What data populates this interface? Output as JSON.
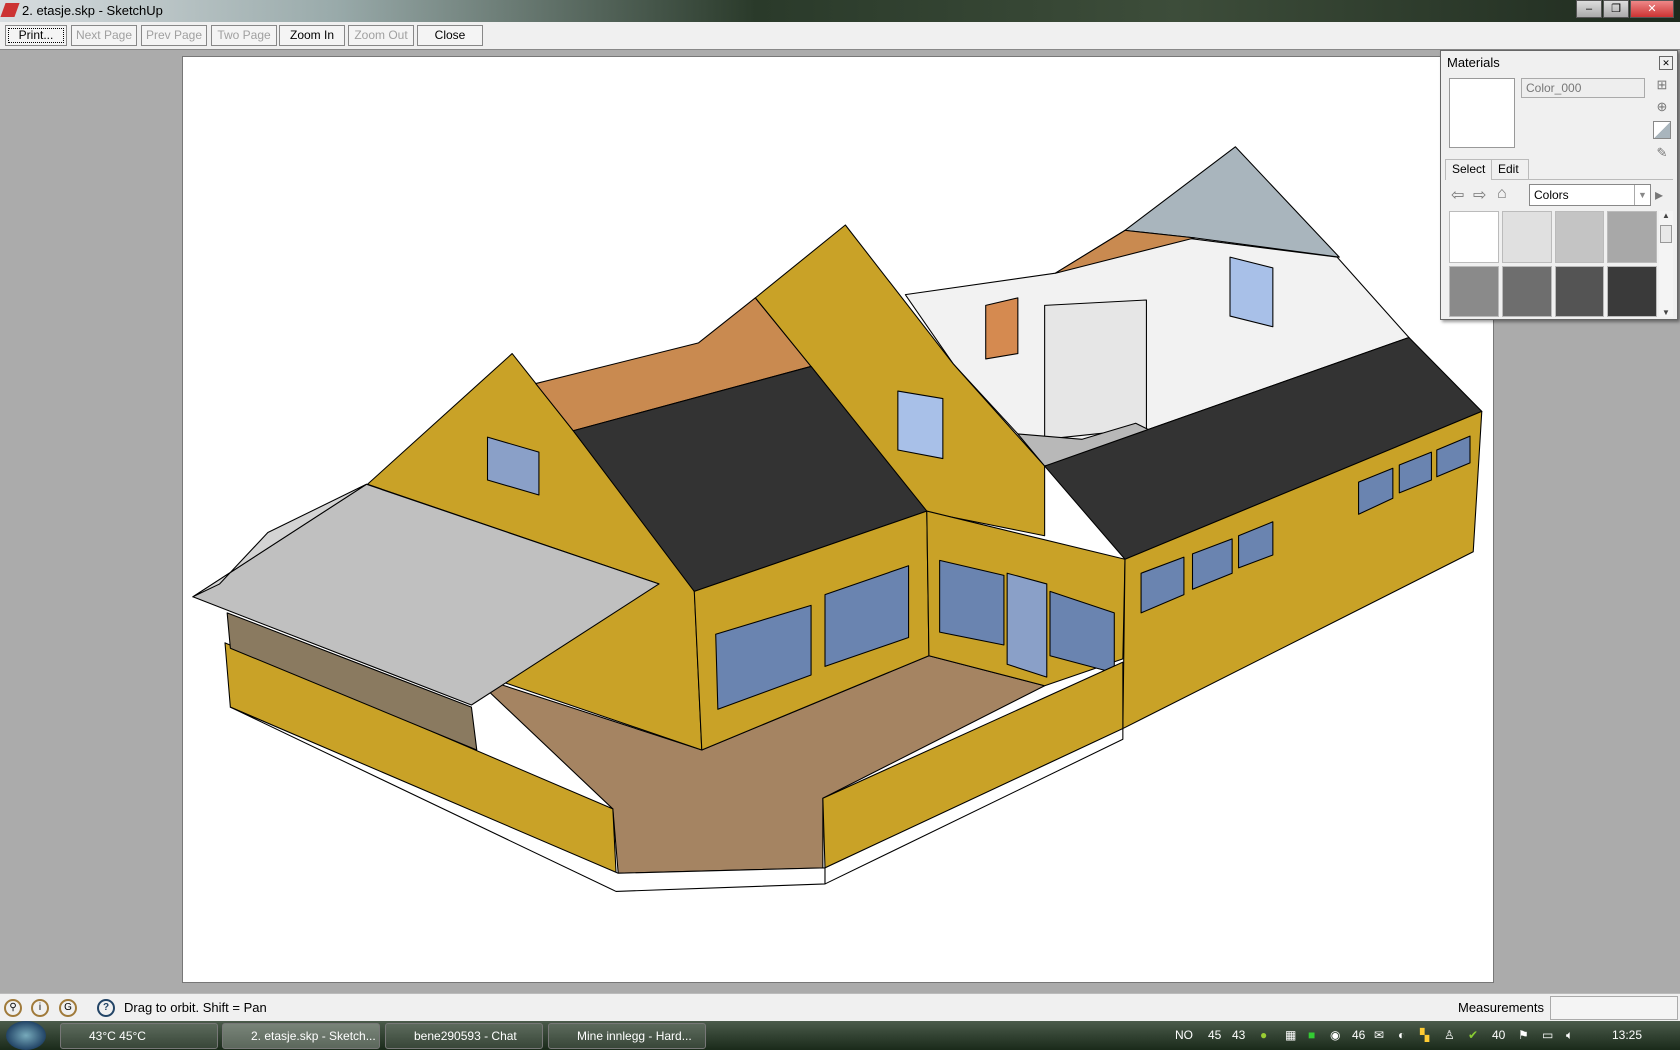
{
  "window": {
    "title": "2. etasje.skp - SketchUp"
  },
  "toolbar": {
    "print": "Print...",
    "next_page": "Next Page",
    "prev_page": "Prev Page",
    "two_page": "Two Page",
    "zoom_in": "Zoom In",
    "zoom_out": "Zoom Out",
    "close": "Close"
  },
  "materials": {
    "title": "Materials",
    "material_name": "Color_000",
    "tab_select": "Select",
    "tab_edit": "Edit",
    "library": "Colors",
    "swatches": [
      "#ffffff",
      "#e0e0e0",
      "#c4c4c4",
      "#a8a8a8",
      "#8a8a8a",
      "#6e6e6e",
      "#545454",
      "#3a3a3a"
    ]
  },
  "statusbar": {
    "hint": "Drag to orbit.  Shift = Pan",
    "measurements_label": "Measurements"
  },
  "taskbar": {
    "items": [
      "43°C 45°C",
      "2. etasje.skp - Sketch...",
      "bene290593 - Chat",
      "Mine innlegg - Hard..."
    ],
    "tray": {
      "lang": "NO",
      "t1": "45",
      "t2": "43",
      "t3": "46",
      "t4": "40",
      "clock": "13:25"
    }
  },
  "colors": {
    "wall": "#c9a227",
    "roof": "#333333",
    "floor": "#a58462",
    "glass": "#6a84b0",
    "canopy": "#c0c0c0",
    "interior": "#f4f4f4",
    "gable_top": "#a9b5bd",
    "orange": "#c98a50"
  }
}
